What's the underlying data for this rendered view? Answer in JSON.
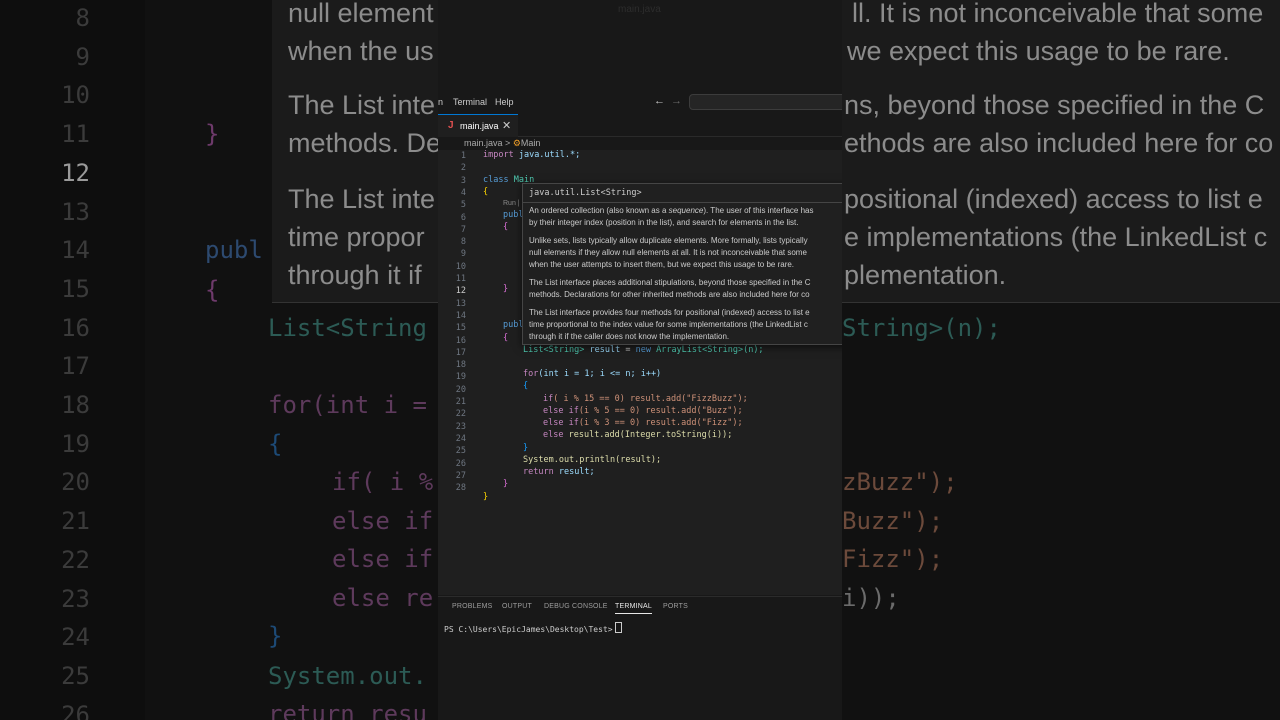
{
  "window": {
    "title": "main.java"
  },
  "menu": {
    "item_n": "n",
    "terminal": "Terminal",
    "help": "Help"
  },
  "nav": {
    "back_icon": "arrow-left-icon",
    "forward_icon": "arrow-right-icon"
  },
  "tab": {
    "icon": "J",
    "label": "main.java",
    "close": "✕"
  },
  "breadcrumb": {
    "file": "main.java",
    "sep": ">",
    "symbol_icon": "class-icon",
    "symbol": "Main"
  },
  "line_numbers": [
    "1",
    "2",
    "3",
    "4",
    "5",
    "6",
    "7",
    "8",
    "9",
    "10",
    "11",
    "12",
    "13",
    "14",
    "15",
    "16",
    "17",
    "18",
    "19",
    "20",
    "21",
    "22",
    "23",
    "24",
    "25",
    "26",
    "27",
    "28"
  ],
  "active_line": "12",
  "code": {
    "l1_kw": "import",
    "l1_rest": " java.util.*;",
    "l3_kw": "class",
    "l3_name": " Main",
    "l4": "{",
    "l5": "publ",
    "codelens": "Run |",
    "l6": "{",
    "l11": "}",
    "l14": "publ",
    "l15": "{",
    "l16_type": "List<String>",
    "l16_var": " result",
    "l16_op": " = ",
    "l16_new": "new",
    "l16_rest": " ArrayList<String>(n);",
    "l18_for": "for",
    "l18_rest": "(int i = 1; i <= n; i++)",
    "l19": "{",
    "l20_if": "if",
    "l20_rest": "( i % 15 == 0) result.add(\"FizzBuzz\");",
    "l21_else": "else if",
    "l21_rest": "(i % 5 == 0) result.add(\"Buzz\");",
    "l22_else": "else if",
    "l22_rest": "(i % 3 == 0) result.add(\"Fizz\");",
    "l23_else": "else",
    "l23_rest": " result.add(Integer.toString(i));",
    "l24": "}",
    "l25": "System.out.println(result);",
    "l26_ret": "return",
    "l26_rest": " result;",
    "l27": "}",
    "l28": "}"
  },
  "hover": {
    "signature": "java.util.List<String>",
    "p1a": "An ordered collection (also known as a ",
    "p1em": "sequence",
    "p1b": "). The user of this interface has",
    "p1c": "by their integer index (position in the list), and search for elements in the list.",
    "p2a": "Unlike sets, lists typically allow duplicate elements. More formally, lists typically",
    "p2b": "null elements if they allow null elements at all. It is not inconceivable that some",
    "p2c": "when the user attempts to insert them, but we expect this usage to be rare.",
    "p3a": "The List interface places additional stipulations, beyond those specified in the C",
    "p3b": "methods. Declarations for other inherited methods are also included here for co",
    "p4a": "The List interface provides four methods for positional (indexed) access to list e",
    "p4b": "time proportional to the index value for some implementations (the LinkedList c",
    "p4c": "through it if the caller does not know the implementation."
  },
  "panel": {
    "tabs": [
      "PROBLEMS",
      "OUTPUT",
      "DEBUG CONSOLE",
      "TERMINAL",
      "PORTS"
    ],
    "active_tab": "TERMINAL",
    "prompt": "PS C:\\Users\\EpicJames\\Desktop\\Test>"
  },
  "background": {
    "line_numbers": [
      "8",
      "9",
      "10",
      "11",
      "12",
      "13",
      "14",
      "15",
      "16",
      "17",
      "18",
      "19",
      "20",
      "21",
      "22",
      "23",
      "24",
      "25",
      "26"
    ],
    "hover_lines": [
      "null element",
      "ll. It is not inconceivable that some",
      "when the us",
      "we expect this usage to be rare.",
      "The List inte",
      "ns, beyond those specified in the C",
      "methods. De",
      "ethods are also included here for co",
      "The List inte",
      "positional (indexed) access to list e",
      "time propor",
      "e implementations (the LinkedList c",
      "through it if",
      "plementation."
    ],
    "code": {
      "b11": "}",
      "b14": "publ",
      "b15": "{",
      "b16a": "List<String",
      "b16b": "String>(n);",
      "b18": "for(int i =",
      "b19": "{",
      "b20a": "if( i %",
      "b20b": "zBuzz\");",
      "b21a": "else if",
      "b21b": "Buzz\");",
      "b22a": "else if",
      "b22b": "Fizz\");",
      "b23a": "else re",
      "b23b": "i));",
      "b24": "}",
      "b25": "System.out.",
      "b26": "return resu"
    }
  }
}
